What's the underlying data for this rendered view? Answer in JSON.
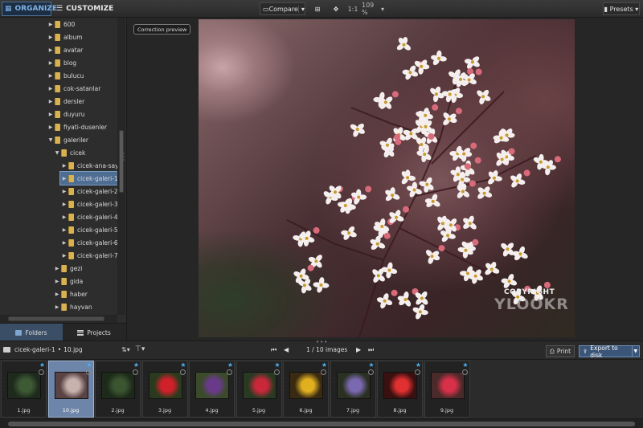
{
  "top": {
    "organize": "ORGANIZE",
    "customize": "CUSTOMIZE",
    "compare": "Compare",
    "one_to_one": "1:1",
    "zoom": "109 %",
    "presets": "Presets"
  },
  "tree": {
    "items": [
      {
        "label": "600",
        "level": 1,
        "state": "collapsed"
      },
      {
        "label": "album",
        "level": 1,
        "state": "collapsed"
      },
      {
        "label": "avatar",
        "level": 1,
        "state": "collapsed"
      },
      {
        "label": "blog",
        "level": 1,
        "state": "collapsed"
      },
      {
        "label": "bulucu",
        "level": 1,
        "state": "collapsed"
      },
      {
        "label": "cok-satanlar",
        "level": 1,
        "state": "collapsed"
      },
      {
        "label": "dersler",
        "level": 1,
        "state": "collapsed"
      },
      {
        "label": "duyuru",
        "level": 1,
        "state": "collapsed"
      },
      {
        "label": "fiyati-dusenler",
        "level": 1,
        "state": "collapsed"
      },
      {
        "label": "galeriler",
        "level": 1,
        "state": "expanded"
      },
      {
        "label": "cicek",
        "level": 2,
        "state": "expanded"
      },
      {
        "label": "cicek-ana-sayfa",
        "level": 3,
        "state": "collapsed"
      },
      {
        "label": "cicek-galeri-1",
        "level": 3,
        "state": "collapsed",
        "selected": true
      },
      {
        "label": "cicek-galeri-2",
        "level": 3,
        "state": "collapsed"
      },
      {
        "label": "cicek-galeri-3",
        "level": 3,
        "state": "collapsed"
      },
      {
        "label": "cicek-galeri-4",
        "level": 3,
        "state": "collapsed"
      },
      {
        "label": "cicek-galeri-5",
        "level": 3,
        "state": "collapsed"
      },
      {
        "label": "cicek-galeri-6",
        "level": 3,
        "state": "collapsed"
      },
      {
        "label": "cicek-galeri-7",
        "level": 3,
        "state": "collapsed"
      },
      {
        "label": "gezi",
        "level": 2,
        "state": "collapsed"
      },
      {
        "label": "gida",
        "level": 2,
        "state": "collapsed"
      },
      {
        "label": "haber",
        "level": 2,
        "state": "collapsed"
      },
      {
        "label": "hayvan",
        "level": 2,
        "state": "collapsed"
      }
    ]
  },
  "panel_tabs": {
    "folders": "Folders",
    "projects": "Projects"
  },
  "preview": {
    "badge": "Correction preview",
    "copyright": "COPYRIGHT",
    "mark": "YLOOKR"
  },
  "strip": {
    "folder": "cicek-galeri-1",
    "separator": "•",
    "file": "10.jpg",
    "count": "1 / 10  images",
    "print": "Print",
    "export": "Export to disk"
  },
  "thumbs": [
    {
      "name": "1.jpg",
      "colors": [
        "#1e2a1c",
        "#3d5a35"
      ]
    },
    {
      "name": "10.jpg",
      "colors": [
        "#5a4344",
        "#c7b3ae"
      ],
      "selected": true
    },
    {
      "name": "2.jpg",
      "colors": [
        "#1d2a1a",
        "#3a5530"
      ]
    },
    {
      "name": "3.jpg",
      "colors": [
        "#2a3a1e",
        "#d0202a"
      ]
    },
    {
      "name": "4.jpg",
      "colors": [
        "#3a4a2a",
        "#6a3a8a"
      ]
    },
    {
      "name": "5.jpg",
      "colors": [
        "#2a3a22",
        "#c8283a"
      ]
    },
    {
      "name": "6.jpg",
      "colors": [
        "#3a2a12",
        "#e0b020"
      ]
    },
    {
      "name": "7.jpg",
      "colors": [
        "#2a3022",
        "#7a68b0"
      ]
    },
    {
      "name": "8.jpg",
      "colors": [
        "#3a1010",
        "#e03030"
      ]
    },
    {
      "name": "9.jpg",
      "colors": [
        "#4a2a2a",
        "#d83048"
      ]
    }
  ],
  "colors": {
    "accent": "#7fb2e6",
    "selection": "#4e6d93",
    "star": "#4fb0f0",
    "folder": "#d9b24f"
  }
}
